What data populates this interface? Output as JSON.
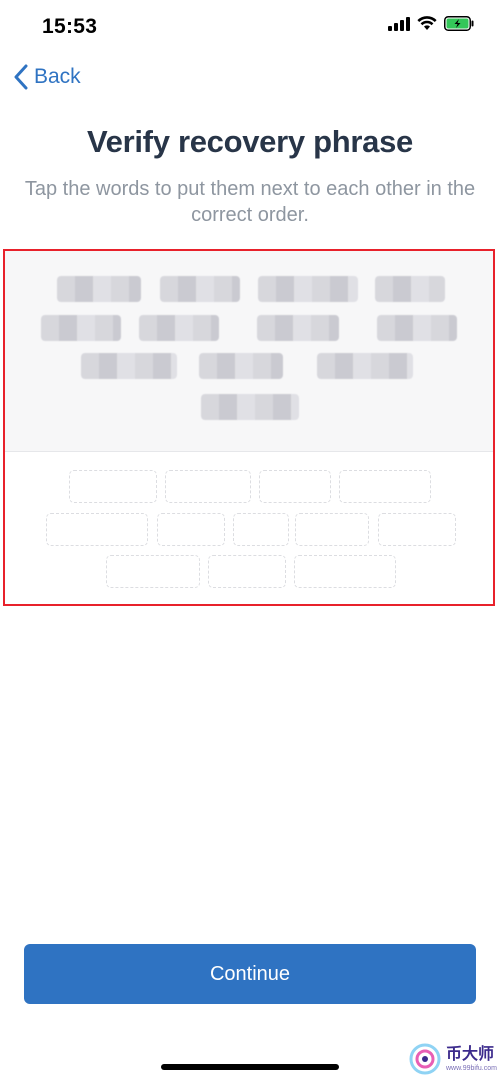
{
  "status_bar": {
    "time": "15:53"
  },
  "nav": {
    "back_label": "Back"
  },
  "header": {
    "title": "Verify recovery phrase",
    "subtitle": "Tap the words to put them next to each other in the correct order."
  },
  "word_pool": {
    "word_count": 12,
    "words_obscured": true
  },
  "answer_slots": {
    "slot_count": 12
  },
  "footer": {
    "continue_label": "Continue"
  },
  "watermark": {
    "main": "币大师",
    "url": "www.99bifu.com"
  },
  "colors": {
    "accent": "#2f73c2",
    "title": "#283548",
    "subtitle": "#8e96a0",
    "highlight_border": "#e8212b",
    "battery": "#34c759"
  }
}
